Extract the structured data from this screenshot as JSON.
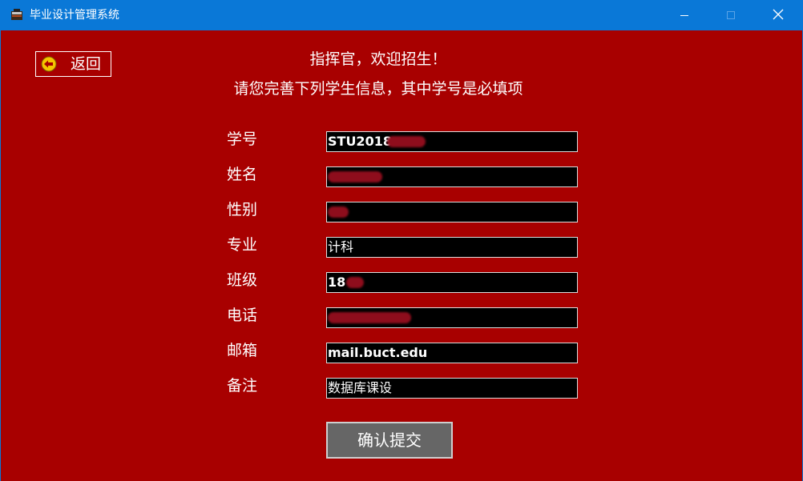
{
  "window": {
    "title": "毕业设计管理系统",
    "min_icon": "minimize-icon",
    "max_icon": "maximize-icon",
    "close_icon": "close-icon"
  },
  "nav": {
    "back_label": "返回",
    "back_icon": "back-arrow-icon"
  },
  "header": {
    "greeting": "指挥官，欢迎招生！",
    "instruction": "请您完善下列学生信息，其中学号是必填项"
  },
  "form": {
    "fields": [
      {
        "label": "学号",
        "value": "STU2018"
      },
      {
        "label": "姓名",
        "value": ""
      },
      {
        "label": "性别",
        "value": ""
      },
      {
        "label": "专业",
        "value": "计科"
      },
      {
        "label": "班级",
        "value": "18"
      },
      {
        "label": "电话",
        "value": ""
      },
      {
        "label": "邮箱",
        "value": "mail.buct.edu"
      },
      {
        "label": "备注",
        "value": "数据库课设"
      }
    ],
    "submit_label": "确认提交"
  },
  "colors": {
    "background": "#a80000",
    "titlebar": "#0a78d7",
    "input_bg": "#000000",
    "button_bg": "#666666"
  }
}
